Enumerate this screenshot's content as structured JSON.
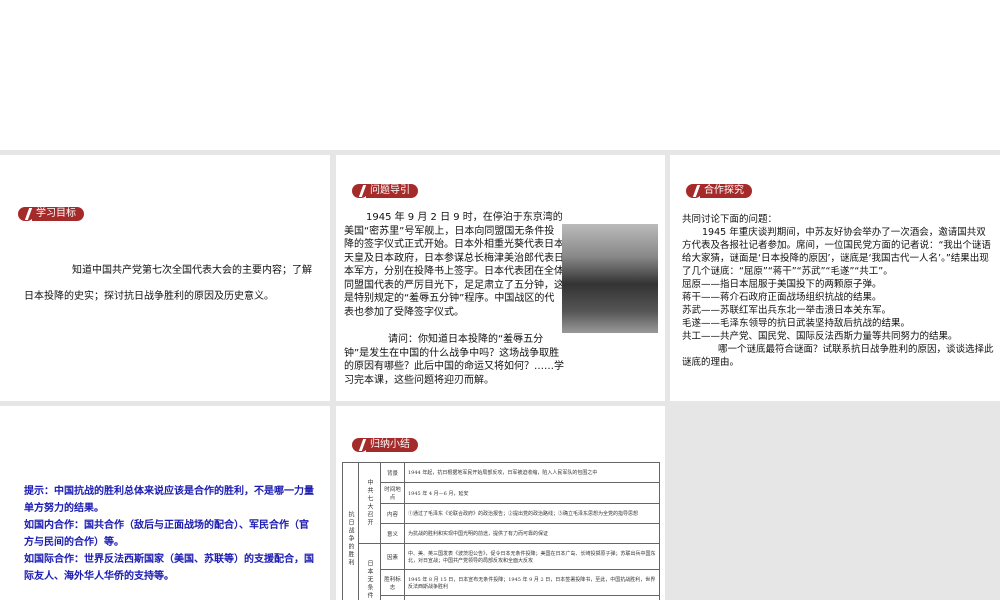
{
  "panels": {
    "goal": {
      "badge": "学习目标",
      "text": "知道中国共产党第七次全国代表大会的主要内容；了解日本投降的史实；探讨抗日战争胜利的原因及历史意义。"
    },
    "intro": {
      "badge": "问题导引",
      "p1": "1945 年 9 月 2 日 9 时，在停泊于东京湾的美国“密苏里”号军舰上，日本向同盟国无条件投降的签字仪式正式开始。日本外相重光葵代表日本天皇及日本政府，日本参谋总长梅津美治郎代表日本军方，分别在投降书上签字。日本代表团在全体同盟国代表的严厉目光下，足足肃立了五分钟，这是特别规定的“羞辱五分钟”程序。中国战区的代表也参加了受降签字仪式。",
      "p2": "请问：你知道日本投降的“羞辱五分钟”是发生在中国的什么战争中吗？这场战争取胜的原因有哪些？此后中国的命运又将如何？……学习完本课，这些问题将迎刃而解。"
    },
    "coop": {
      "badge": "合作探究",
      "lead": "共同讨论下面的问题：",
      "p1": "1945 年重庆谈判期间，中苏友好协会举办了一次酒会，邀请国共双方代表及各报社记者参加。席间，一位国民党方面的记者说：“我出个谜语给大家猜，谜面是‘日本投降的原因’，谜底是‘我国古代一人名’。”结果出现了几个谜底：“屈原”“蒋干”“苏武”“毛遂”“共工”。",
      "items": [
        "屈原——指日本屈服于美国投下的两颗原子弹。",
        "蒋干——蒋介石政府正面战场组织抗战的结果。",
        "苏武——苏联红军出兵东北一举击溃日本关东军。",
        "毛遂——毛泽东领导的抗日武装坚持敌后抗战的结果。",
        "共工——共产党、国民党、国际反法西斯力量等共同努力的结果。"
      ],
      "question": "哪一个谜底最符合谜面？试联系抗日战争胜利的原因，谈谈选择此谜底的理由。"
    },
    "hint": {
      "lines": [
        "提示：中国抗战的胜利总体来说应该是合作的胜利，不是哪一力量单方努力的结果。",
        "如国内合作：国共合作（敌后与正面战场的配合）、军民合作（官方与民间的合作）等。",
        "如国际合作：世界反法西斯国家（美国、苏联等）的支援配合，国际友人、海外华人华侨的支持等。"
      ]
    },
    "summary": {
      "badge": "归纳小结",
      "col1": "抗日战争的胜利",
      "group1": "中共七大召开",
      "group2": "日本无条件",
      "rows": [
        {
          "label": "背景",
          "value": "1944 年起，抗日根据地军民开始局部反攻，日军被迫收缩，陷入人民军队的包围之中"
        },
        {
          "label": "时间地点",
          "value": "1945 年 4 月—6 月，延安"
        },
        {
          "label": "内容",
          "value": "①通过了毛泽东《论联合政府》的政治报告；②提出党的政治路线；③确立毛泽东思想为全党的指导思想"
        },
        {
          "label": "意义",
          "value": "为抗战的胜利和实现中国光明的前途，提供了有力而可靠的保证"
        },
        {
          "label": "因素",
          "value": "中、美、英三国发表《波茨坦公告》，促令日本无条件投降；美国在日本广岛、长崎投掷原子弹；苏联出兵中国东北，对日宣战；中国共产党领导的局部反攻和全面大反攻"
        },
        {
          "label": "胜利标志",
          "value": "1945 年 8 月 15 日，日本宣布无条件投降；1945 年 9 月 2 日，日本签署投降书，至此，中国抗战胜利，世界反法西斯战争胜利"
        }
      ]
    }
  }
}
